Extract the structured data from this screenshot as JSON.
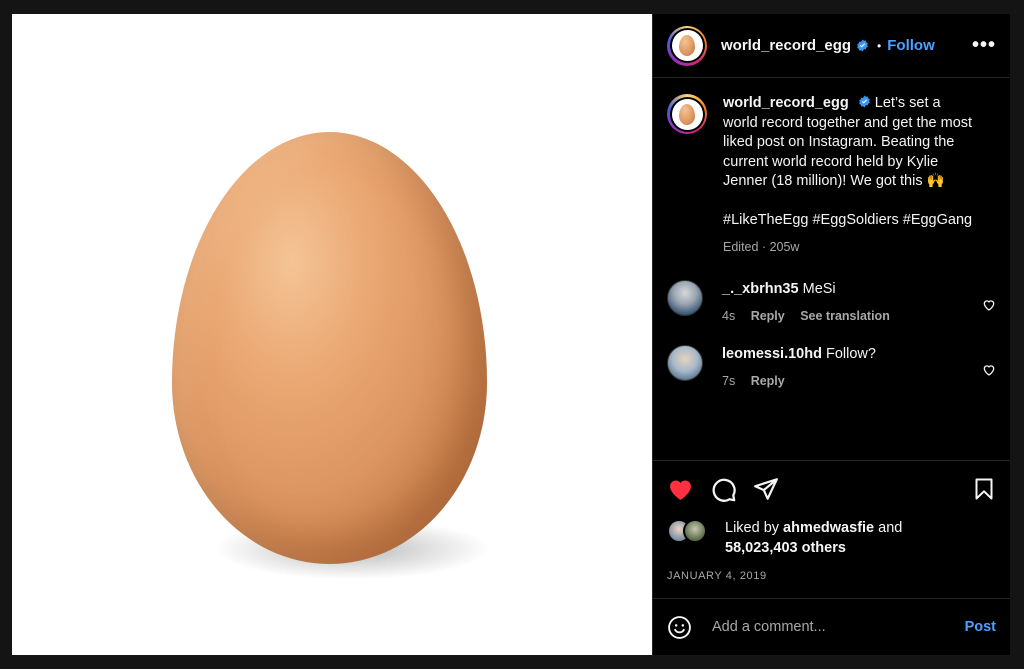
{
  "post": {
    "username": "world_record_egg",
    "follow_label": "Follow",
    "separator": "•",
    "more_label": "•••"
  },
  "caption": {
    "username": "world_record_egg",
    "text": "Let’s set a world record together and get the most liked post on Instagram. Beating the current world record held by Kylie Jenner (18 million)! We got this 🙌",
    "hashtags": "#LikeTheEgg #EggSoldiers #EggGang",
    "edited": "Edited",
    "meta_sep": " · ",
    "age": "205w"
  },
  "comments": [
    {
      "username": "_._xbrhn35",
      "text": "MeSi",
      "age": "4s",
      "reply_label": "Reply",
      "translate_label": "See translation"
    },
    {
      "username": "leomessi.10hd",
      "text": "Follow?",
      "age": "7s",
      "reply_label": "Reply"
    }
  ],
  "likes": {
    "prefix": "Liked by",
    "user": "ahmedwasfie",
    "and": "and",
    "count_text": "58,023,403 others"
  },
  "date": "JANUARY 4, 2019",
  "add_comment": {
    "placeholder": "Add a comment...",
    "post_label": "Post"
  },
  "colors": {
    "accent": "#4ea0ff",
    "like_heart": "#ff3040",
    "verified": "#3897f0"
  },
  "icons": {
    "liked": "heart-filled-icon",
    "comment": "comment-bubble-icon",
    "share": "paper-plane-icon",
    "save": "bookmark-icon",
    "emoji": "smiley-icon",
    "comment_like": "heart-outline-icon"
  }
}
